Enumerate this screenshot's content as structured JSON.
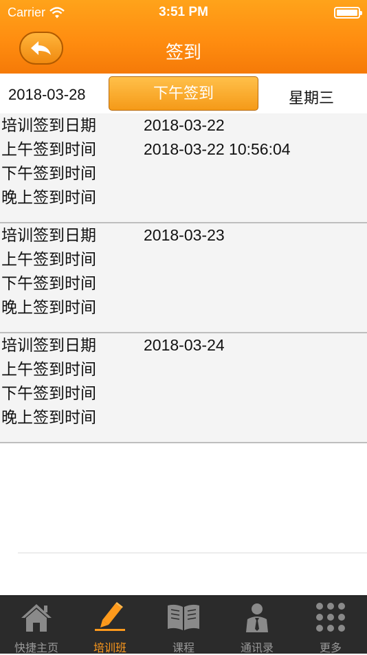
{
  "status_bar": {
    "carrier": "Carrier",
    "time": "3:51 PM"
  },
  "header": {
    "title": "签到",
    "back_icon": "back-arrow-icon"
  },
  "date_row": {
    "date": "2018-03-28",
    "button_label": "下午签到",
    "weekday": "星期三"
  },
  "records": [
    {
      "rows": [
        {
          "label": "培训签到日期",
          "value": "2018-03-22"
        },
        {
          "label": "上午签到时间",
          "value": "2018-03-22 10:56:04"
        },
        {
          "label": "下午签到时间",
          "value": ""
        },
        {
          "label": "晚上签到时间",
          "value": ""
        }
      ]
    },
    {
      "rows": [
        {
          "label": "培训签到日期",
          "value": "2018-03-23"
        },
        {
          "label": "上午签到时间",
          "value": ""
        },
        {
          "label": "下午签到时间",
          "value": ""
        },
        {
          "label": "晚上签到时间",
          "value": ""
        }
      ]
    },
    {
      "rows": [
        {
          "label": "培训签到日期",
          "value": "2018-03-24"
        },
        {
          "label": "上午签到时间",
          "value": ""
        },
        {
          "label": "下午签到时间",
          "value": ""
        },
        {
          "label": "晚上签到时间",
          "value": ""
        }
      ]
    }
  ],
  "tabs": [
    {
      "label": "快捷主页",
      "icon": "home-icon",
      "active": false
    },
    {
      "label": "培训班",
      "icon": "pencil-icon",
      "active": true
    },
    {
      "label": "课程",
      "icon": "book-icon",
      "active": false
    },
    {
      "label": "通讯录",
      "icon": "contact-person-icon",
      "active": false
    },
    {
      "label": "更多",
      "icon": "grid-dots-icon",
      "active": false
    }
  ],
  "colors": {
    "header": "#ff8d10",
    "accent": "#ff9a1c",
    "tabbar": "#2b2b2b"
  }
}
